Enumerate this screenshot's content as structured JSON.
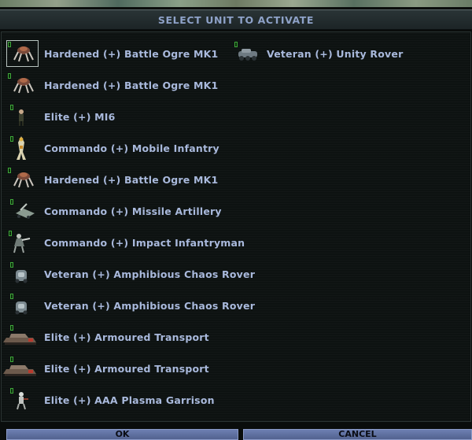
{
  "dialog": {
    "title": "SELECT UNIT TO ACTIVATE",
    "ok_label": "OK",
    "cancel_label": "CANCEL"
  },
  "units": [
    {
      "label": "Hardened (+) Battle Ogre MK1",
      "icon": "battle-ogre-icon",
      "selected": true
    },
    {
      "label": "Veteran (+) Unity Rover",
      "icon": "unity-rover-icon"
    },
    {
      "label": "Hardened (+) Battle Ogre MK1",
      "icon": "battle-ogre-icon"
    },
    {
      "label": "Elite (+) MI6",
      "icon": "mi6-agent-icon"
    },
    {
      "label": "Commando (+) Mobile Infantry",
      "icon": "mobile-infantry-icon"
    },
    {
      "label": "Hardened (+) Battle Ogre MK1",
      "icon": "battle-ogre-icon"
    },
    {
      "label": "Commando (+) Missile Artillery",
      "icon": "missile-artillery-icon"
    },
    {
      "label": "Commando (+) Impact Infantryman",
      "icon": "impact-infantryman-icon"
    },
    {
      "label": "Veteran (+) Amphibious Chaos Rover",
      "icon": "chaos-rover-icon"
    },
    {
      "label": "Veteran (+) Amphibious Chaos Rover",
      "icon": "chaos-rover-icon"
    },
    {
      "label": "Elite (+) Armoured Transport",
      "icon": "armoured-transport-icon"
    },
    {
      "label": "Elite (+) Armoured Transport",
      "icon": "armoured-transport-icon"
    },
    {
      "label": "Elite (+) AAA Plasma Garrison",
      "icon": "plasma-garrison-icon"
    }
  ],
  "colors": {
    "label_text": "#a9b9dc",
    "title_text": "#8ea2c8",
    "background": "#0d1211",
    "button": "#5e6f9f"
  }
}
